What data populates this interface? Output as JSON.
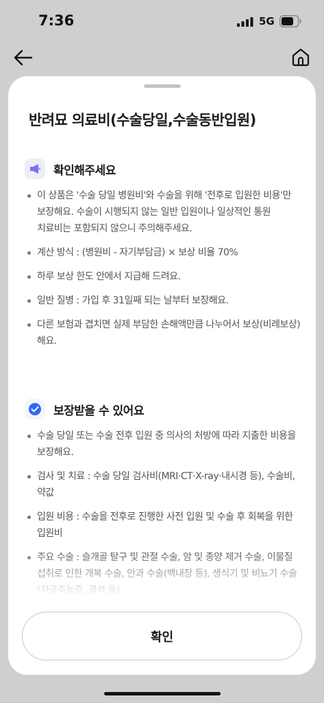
{
  "status_bar": {
    "time": "7:36",
    "network": "5G",
    "icons": [
      "signal-icon",
      "battery-icon"
    ]
  },
  "nav": {
    "icons": [
      "back-arrow-icon",
      "home-icon"
    ]
  },
  "sheet": {
    "title": "반려묘 의료비(수술당일,수술동반입원)",
    "sections": [
      {
        "icon": "megaphone-icon",
        "icon_color": "#7b6ff0",
        "title": "확인해주세요",
        "items": [
          "이 상품은 '수술 당일 병원비'와 수술을 위해 '전후로 입원한 비용'만 보장해요. 수술이 시행되지 않는 일반 입원이나 일상적인 통원 치료비는 포함되지 않으니 주의해주세요.",
          "계산 방식 : (병원비 - 자기부담금) × 보상 비율 70%",
          "하루 보상 한도 안에서 지급해 드려요.",
          "일반 질병 : 가입 후 31일째 되는 날부터 보장해요.",
          "다른 보험과 겹치면 실제 부담한 손해액만큼 나누어서 보상(비례보상)해요."
        ]
      },
      {
        "icon": "check-circle-icon",
        "icon_color": "#2f6bf0",
        "title": "보장받을 수 있어요",
        "items": [
          "수술 당일 또는 수술 전후 입원 중 의사의 처방에 따라 지출한 비용을 보장해요.",
          "검사 및 치료 : 수술 당일 검사비(MRI·CT·X-ray·내시경 등), 수술비, 약값",
          "입원 비용 : 수술을 전후로 진행한 사전 입원 및 수술 후 회복을 위한 입원비",
          "주요 수술 : 슬개골 탈구 및 관절 수술, 암 및 종양 제거 수술, 이물질 섭취로 인한 개복 수술, 안과 수술(백내장 등), 생식기 및 비뇨기 수술(자궁축농증, 결석 등)"
        ]
      }
    ],
    "confirm_label": "확인"
  }
}
